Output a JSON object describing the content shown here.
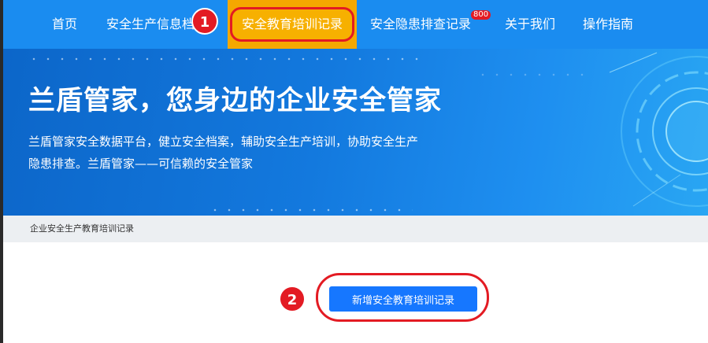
{
  "nav": {
    "items": [
      {
        "label": "首页"
      },
      {
        "label": "安全生产信息档"
      },
      {
        "label": "安全教育培训记录"
      },
      {
        "label": "安全隐患排查记录"
      },
      {
        "label": "关于我们"
      },
      {
        "label": "操作指南"
      }
    ],
    "badge": "800",
    "active_index": 2
  },
  "annotations": {
    "step1": "1",
    "step2": "2"
  },
  "hero": {
    "title": "兰盾管家，您身边的企业安全管家",
    "desc_line1": "兰盾管家安全数据平台，健立安全档案，辅助安全生产培训，协助安全生产",
    "desc_line2": "隐患排查。兰盾管家——可信赖的安全管家"
  },
  "breadcrumb": {
    "text": "企业安全生产教育培训记录"
  },
  "main": {
    "add_button_label": "新增安全教育培训记录"
  },
  "colors": {
    "nav_bg": "#1a8cf0",
    "active_bg": "#f5a800",
    "annotation_red": "#e31b23",
    "button_blue": "#1677ff"
  }
}
